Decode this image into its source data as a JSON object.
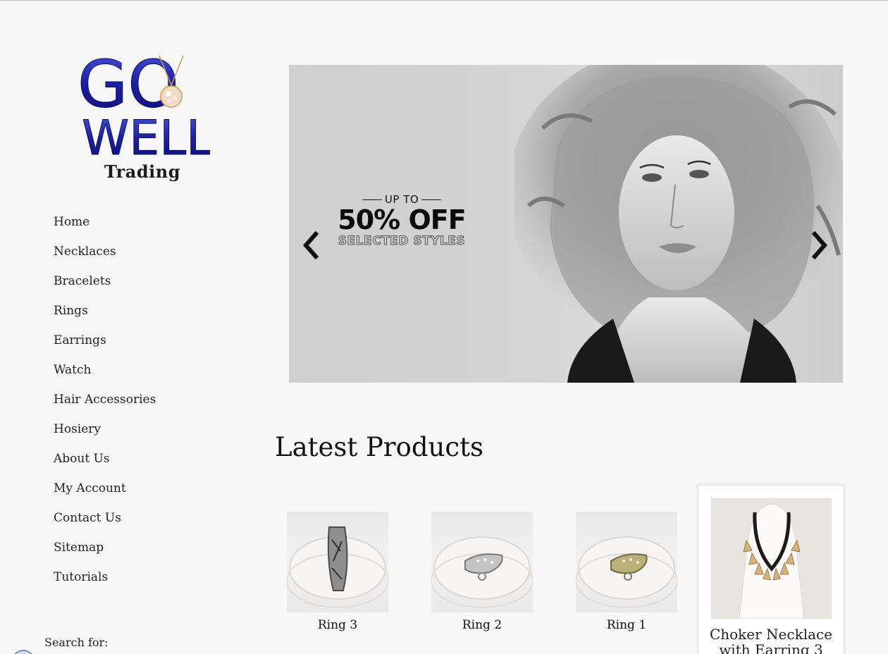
{
  "brand": {
    "logo_text_top": "GO",
    "logo_text_bottom": "WELL",
    "logo_subtitle": "Trading",
    "logo_color": "#1b1fa8"
  },
  "nav": {
    "items": [
      {
        "label": "Home"
      },
      {
        "label": "Necklaces"
      },
      {
        "label": "Bracelets"
      },
      {
        "label": "Rings"
      },
      {
        "label": "Earrings"
      },
      {
        "label": "Watch"
      },
      {
        "label": "Hair Accessories"
      },
      {
        "label": "Hosiery"
      },
      {
        "label": "About Us"
      },
      {
        "label": "My Account"
      },
      {
        "label": "Contact Us"
      },
      {
        "label": "Sitemap"
      },
      {
        "label": "Tutorials"
      }
    ]
  },
  "search": {
    "label": "Search for:"
  },
  "banner": {
    "promo_upto": "UP TO",
    "promo_off": "50% OFF",
    "promo_selected": "SELECTED STYLES",
    "prev_icon": "chevron-left-icon",
    "next_icon": "chevron-right-icon"
  },
  "latest": {
    "title": "Latest Products",
    "products": [
      {
        "name": "Ring 3"
      },
      {
        "name": "Ring 2"
      },
      {
        "name": "Ring 1"
      }
    ],
    "featured": {
      "name": "Choker Necklace with Earring 3"
    }
  }
}
